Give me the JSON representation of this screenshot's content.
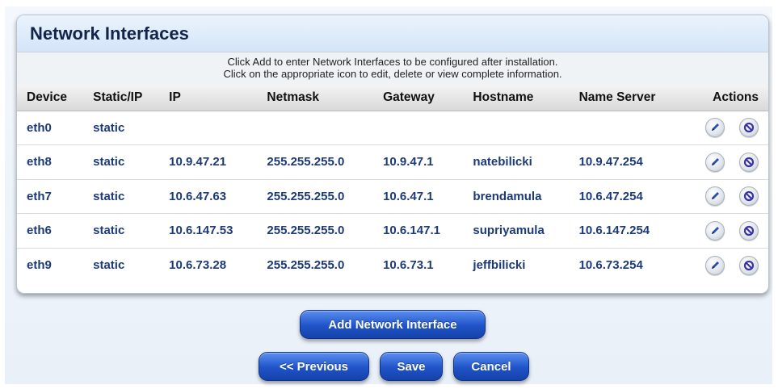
{
  "panel": {
    "title": "Network Interfaces",
    "instructions_line1": "Click Add to enter Network Interfaces to be configured after installation.",
    "instructions_line2": "Click on the appropriate icon to edit, delete or view complete information."
  },
  "table": {
    "columns": [
      "Device",
      "Static/IP",
      "IP",
      "Netmask",
      "Gateway",
      "Hostname",
      "Name Server",
      "Actions"
    ],
    "rows": [
      {
        "device": "eth0",
        "mode": "static",
        "ip": "",
        "netmask": "",
        "gateway": "",
        "hostname": "",
        "nameserver": ""
      },
      {
        "device": "eth8",
        "mode": "static",
        "ip": "10.9.47.21",
        "netmask": "255.255.255.0",
        "gateway": "10.9.47.1",
        "hostname": "natebilicki",
        "nameserver": "10.9.47.254"
      },
      {
        "device": "eth7",
        "mode": "static",
        "ip": "10.6.47.63",
        "netmask": "255.255.255.0",
        "gateway": "10.6.47.1",
        "hostname": "brendamula",
        "nameserver": "10.6.47.254"
      },
      {
        "device": "eth6",
        "mode": "static",
        "ip": "10.6.147.53",
        "netmask": "255.255.255.0",
        "gateway": "10.6.147.1",
        "hostname": "supriyamula",
        "nameserver": "10.6.147.254"
      },
      {
        "device": "eth9",
        "mode": "static",
        "ip": "10.6.73.28",
        "netmask": "255.255.255.0",
        "gateway": "10.6.73.1",
        "hostname": "jeffbilicki",
        "nameserver": "10.6.73.254"
      }
    ],
    "row_actions": [
      "edit-icon",
      "delete-icon"
    ]
  },
  "buttons": {
    "add": "Add Network Interface",
    "previous": "<< Previous",
    "save": "Save",
    "cancel": "Cancel"
  },
  "colors": {
    "accent_blue": "#1f53c8",
    "cell_text": "#1d3a78",
    "header_text": "#12244a"
  }
}
